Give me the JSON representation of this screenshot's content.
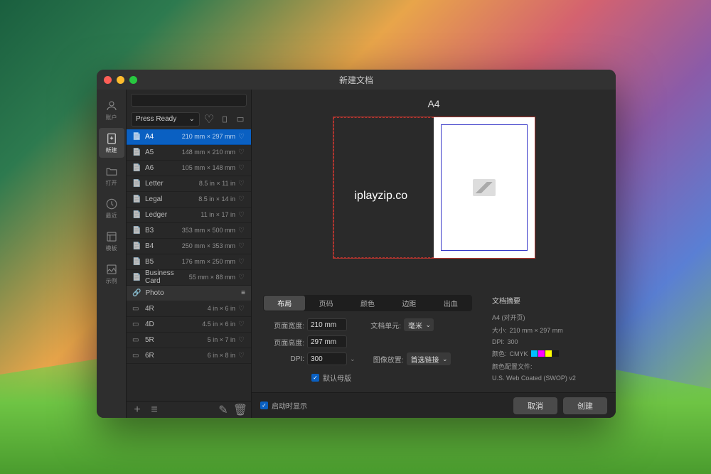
{
  "window": {
    "title": "新建文档"
  },
  "sidebar": {
    "items": [
      {
        "label": "账户",
        "icon": "user"
      },
      {
        "label": "新建",
        "icon": "new-doc"
      },
      {
        "label": "打开",
        "icon": "folder"
      },
      {
        "label": "最近",
        "icon": "clock"
      },
      {
        "label": "模板",
        "icon": "template"
      },
      {
        "label": "示例",
        "icon": "image"
      }
    ]
  },
  "presets": {
    "category_label": "Press Ready",
    "photo_category": "Photo",
    "items": [
      {
        "name": "A4",
        "dim": "210 mm × 297 mm",
        "selected": true
      },
      {
        "name": "A5",
        "dim": "148 mm × 210 mm"
      },
      {
        "name": "A6",
        "dim": "105 mm × 148 mm"
      },
      {
        "name": "Letter",
        "dim": "8.5 in × 11 in"
      },
      {
        "name": "Legal",
        "dim": "8.5 in × 14 in"
      },
      {
        "name": "Ledger",
        "dim": "11 in × 17 in"
      },
      {
        "name": "B3",
        "dim": "353 mm × 500 mm"
      },
      {
        "name": "B4",
        "dim": "250 mm × 353 mm"
      },
      {
        "name": "B5",
        "dim": "176 mm × 250 mm"
      },
      {
        "name": "Business Card",
        "dim": "55 mm × 88 mm"
      }
    ],
    "photo_items": [
      {
        "name": "4R",
        "dim": "4 in × 6 in"
      },
      {
        "name": "4D",
        "dim": "4.5 in × 6 in"
      },
      {
        "name": "5R",
        "dim": "5 in × 7 in"
      },
      {
        "name": "6R",
        "dim": "6 in × 8 in"
      }
    ]
  },
  "preview": {
    "title": "A4",
    "watermark": "iplayzip.co"
  },
  "tabs": [
    "布局",
    "页码",
    "颜色",
    "边距",
    "出血"
  ],
  "form": {
    "width_label": "页面宽度:",
    "width_value": "210 mm",
    "height_label": "页面高度:",
    "height_value": "297 mm",
    "dpi_label": "DPI:",
    "dpi_value": "300",
    "unit_label": "文档单元:",
    "unit_value": "毫米",
    "placement_label": "图像放置:",
    "placement_value": "首选链接",
    "default_master": "默认母版"
  },
  "summary": {
    "title": "文档摘要",
    "preset": "A4 (对开页)",
    "size_label": "大小:",
    "size_value": "210 mm × 297 mm",
    "dpi_label": "DPI:",
    "dpi_value": "300",
    "color_label": "颜色:",
    "color_value": "CMYK",
    "profile_label": "颜色配置文件:",
    "profile_value": "U.S. Web Coated (SWOP) v2",
    "swatches": [
      "#00bfff",
      "#ff00ff",
      "#ffff00",
      "#1a1a1a"
    ]
  },
  "bottom": {
    "startup_label": "启动时显示",
    "cancel": "取消",
    "create": "创建"
  }
}
